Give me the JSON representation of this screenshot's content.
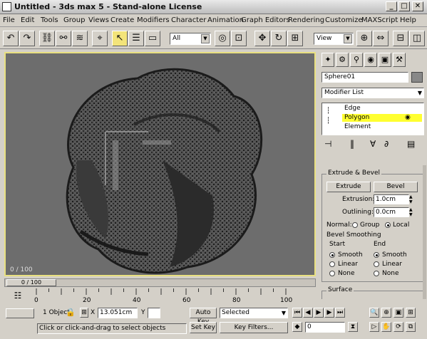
{
  "window": {
    "title": "Untitled - 3ds max 5 - Stand-alone License",
    "minimize": "_",
    "maximize": "□",
    "close": "✕"
  },
  "menu": [
    "File",
    "Edit",
    "Tools",
    "Group",
    "Views",
    "Create",
    "Modifiers",
    "Character",
    "Animation",
    "Graph Editors",
    "Rendering",
    "Customize",
    "MAXScript",
    "Help"
  ],
  "toolbar": {
    "selection_filter": "All",
    "reference_coord": "View"
  },
  "viewport": {
    "frame_counter": "0 / 100"
  },
  "command_panel": {
    "object_name": "Sphere01",
    "modifier_list": "Modifier List",
    "stack_items": [
      {
        "label": "Edge",
        "selected": false
      },
      {
        "label": "Polygon",
        "selected": true
      },
      {
        "label": "Element",
        "selected": false
      }
    ],
    "extrude_bevel": {
      "title": "Extrude & Bevel",
      "extrude_button": "Extrude",
      "bevel_button": "Bevel",
      "extrusion_label": "Extrusion:",
      "extrusion_value": "1.0cm",
      "outlining_label": "Outlining:",
      "outlining_value": "0.0cm",
      "normal_label": "Normal:",
      "normal_group": "Group",
      "normal_local": "Local",
      "bevel_smoothing_label": "Bevel Smoothing",
      "start_label": "Start",
      "end_label": "End",
      "start_options": [
        "Smooth",
        "Linear",
        "None"
      ],
      "end_options": [
        "Smooth",
        "Linear",
        "None"
      ]
    },
    "surface_title": "Surface"
  },
  "timeline": {
    "ticks": [
      "0",
      "20",
      "40",
      "60",
      "80",
      "100"
    ]
  },
  "status": {
    "object_count": "1 Object",
    "x_label": "X",
    "x_value": "13.051cm",
    "y_label": "Y",
    "y_value": "",
    "auto_key": "Auto Key",
    "key_mode": "Selected",
    "set_key": "Set Key",
    "key_filters": "Key Filters...",
    "prompt": "Click or click-and-drag to select objects",
    "frame_value": "0"
  },
  "colors": {
    "chrome": "#d4d0c8",
    "viewport_bg": "#6a6a6a",
    "selection_yellow": "#ffff30",
    "active_border": "#e8e080"
  }
}
